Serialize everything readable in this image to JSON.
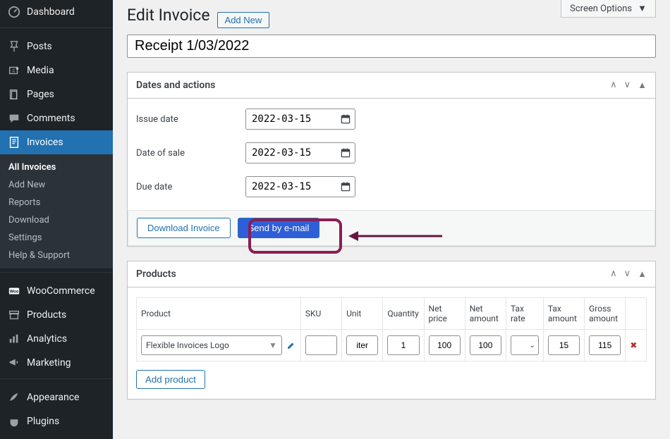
{
  "header": {
    "screen_options": "Screen Options",
    "page_title": "Edit Invoice",
    "add_new": "Add New",
    "doc_title": "Receipt 1/03/2022"
  },
  "sidebar": {
    "items": [
      {
        "label": "Dashboard",
        "icon": "dashboard"
      },
      {
        "label": "Posts",
        "icon": "pin"
      },
      {
        "label": "Media",
        "icon": "media"
      },
      {
        "label": "Pages",
        "icon": "page"
      },
      {
        "label": "Comments",
        "icon": "comment"
      },
      {
        "label": "Invoices",
        "icon": "invoice",
        "active": true
      }
    ],
    "invoice_sub": [
      {
        "label": "All Invoices",
        "bold": true
      },
      {
        "label": "Add New"
      },
      {
        "label": "Reports"
      },
      {
        "label": "Download"
      },
      {
        "label": "Settings"
      },
      {
        "label": "Help & Support"
      }
    ],
    "lower": [
      {
        "label": "WooCommerce",
        "icon": "woo"
      },
      {
        "label": "Products",
        "icon": "archive"
      },
      {
        "label": "Analytics",
        "icon": "chart"
      },
      {
        "label": "Marketing",
        "icon": "megaphone"
      }
    ],
    "bottom": [
      {
        "label": "Appearance",
        "icon": "brush"
      },
      {
        "label": "Plugins",
        "icon": "plugin"
      }
    ]
  },
  "dates_box": {
    "title": "Dates and actions",
    "issue_label": "Issue date",
    "issue_value": "2022-03-15",
    "sale_label": "Date of sale",
    "sale_value": "2022-03-15",
    "due_label": "Due date",
    "due_value": "2022-03-15",
    "download_btn": "Download Invoice",
    "send_btn": "Send by e-mail"
  },
  "products_box": {
    "title": "Products",
    "cols": {
      "product": "Product",
      "sku": "SKU",
      "unit": "Unit",
      "qty": "Quantity",
      "net_price": "Net price",
      "net_amount": "Net amount",
      "tax_rate": "Tax rate",
      "tax_amount": "Tax amount",
      "gross": "Gross amount"
    },
    "row": {
      "product": "Flexible Invoices Logo",
      "sku": "",
      "unit": "iter",
      "qty": "1",
      "net_price": "100",
      "net_amount": "100",
      "tax_rate": "",
      "tax_amount": "15",
      "gross": "115"
    },
    "add_btn": "Add product"
  }
}
